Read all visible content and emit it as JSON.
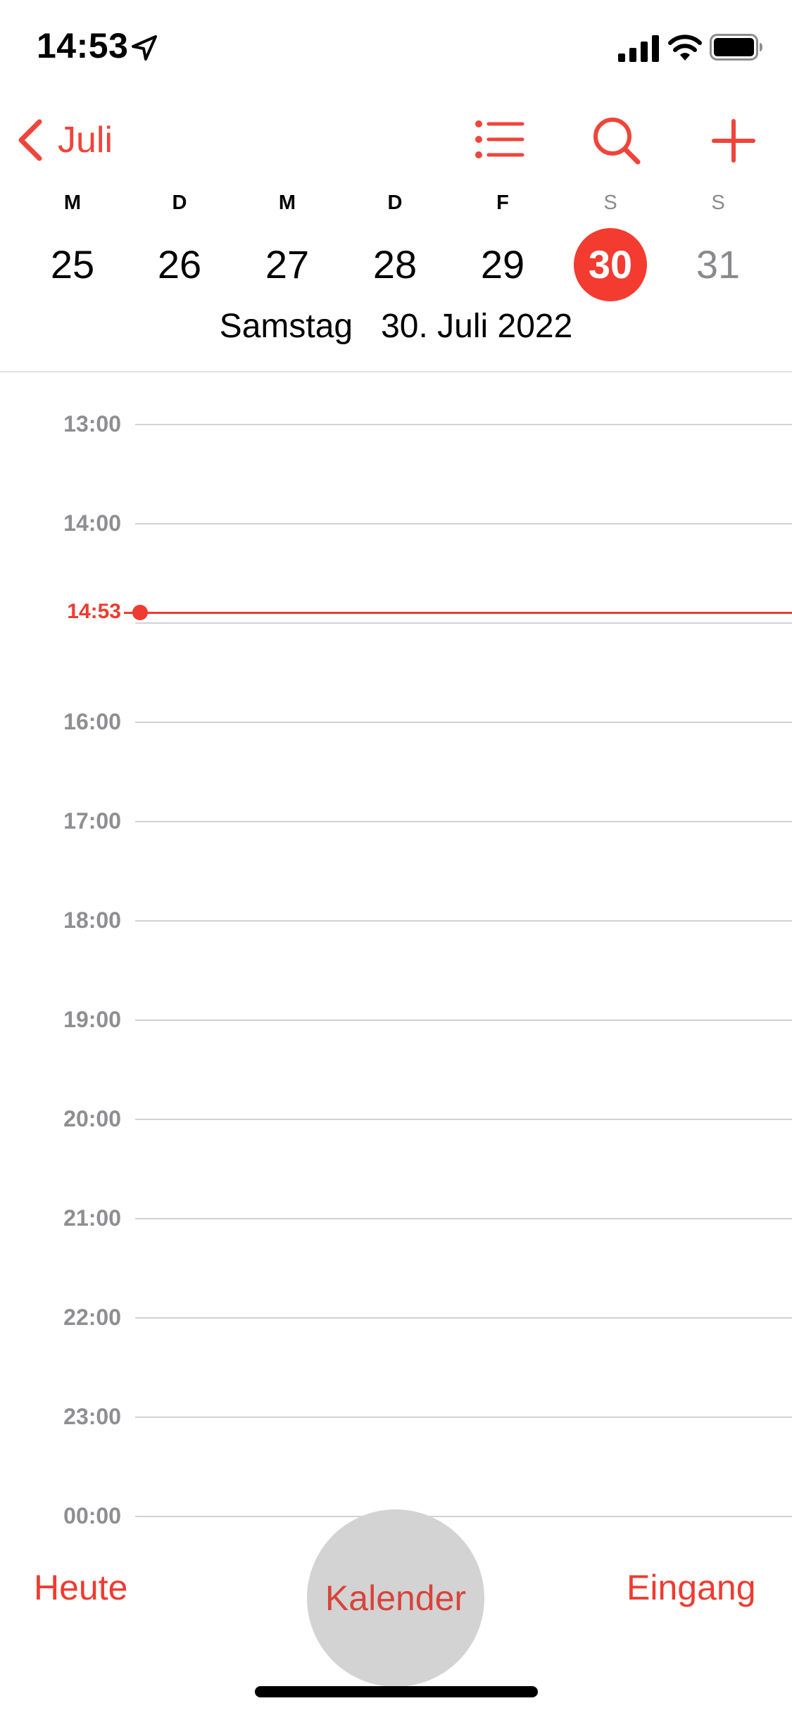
{
  "status_bar": {
    "time": "14:53",
    "icons": [
      "location-arrow-icon",
      "cellular-signal-icon",
      "wifi-icon",
      "battery-icon"
    ]
  },
  "nav": {
    "back_label": "Juli",
    "icons": [
      "chevron-left-icon",
      "list-icon",
      "search-icon",
      "plus-icon"
    ]
  },
  "week": {
    "days": [
      {
        "letter": "M",
        "number": "25",
        "weekend": false,
        "selected": false
      },
      {
        "letter": "D",
        "number": "26",
        "weekend": false,
        "selected": false
      },
      {
        "letter": "M",
        "number": "27",
        "weekend": false,
        "selected": false
      },
      {
        "letter": "D",
        "number": "28",
        "weekend": false,
        "selected": false
      },
      {
        "letter": "F",
        "number": "29",
        "weekend": false,
        "selected": false
      },
      {
        "letter": "S",
        "number": "30",
        "weekend": true,
        "selected": true
      },
      {
        "letter": "S",
        "number": "31",
        "weekend": true,
        "selected": false
      }
    ],
    "date_title": "Samstag   30. Juli 2022"
  },
  "timeline": {
    "hours": [
      "13:00",
      "14:00",
      "16:00",
      "17:00",
      "18:00",
      "19:00",
      "20:00",
      "21:00",
      "22:00",
      "23:00",
      "00:00"
    ],
    "current_time": "14:53"
  },
  "toolbar": {
    "today_label": "Heute",
    "calendar_label": "Kalender",
    "inbox_label": "Eingang"
  },
  "colors": {
    "accent": "#f33b30",
    "grid_line": "#d2d2d6",
    "secondary_text": "#8e8e93"
  }
}
